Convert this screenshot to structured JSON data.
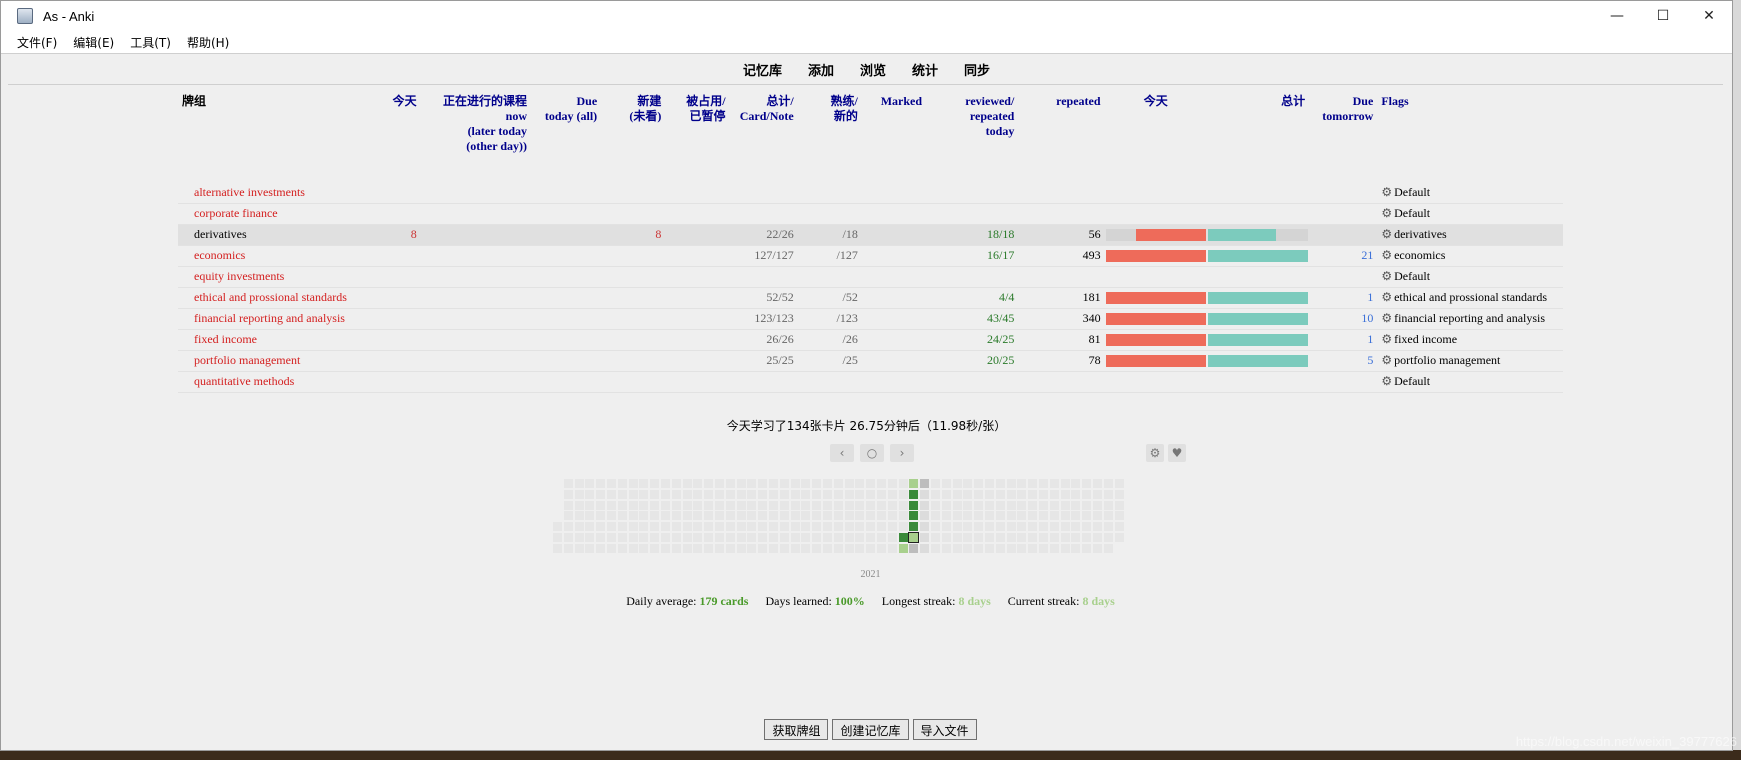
{
  "window": {
    "title": "As - Anki",
    "minimize": "—",
    "maximize": "☐",
    "close": "✕"
  },
  "menu": [
    "文件(F)",
    "编辑(E)",
    "工具(T)",
    "帮助(H)"
  ],
  "toolbar": [
    "记忆库",
    "添加",
    "浏览",
    "统计",
    "同步"
  ],
  "headers": {
    "deck": "牌组",
    "today": "今天",
    "learning": "正在进行的课程\nnow\n(later today\n(other day))",
    "due": "Due\ntoday (all)",
    "new": "新建\n(未看)",
    "buried": "被占用/\n已暂停",
    "total": "总计/\nCard/Note",
    "mature": "熟练/\n新的",
    "marked": "Marked",
    "reviewed": "reviewed/\nrepeated\ntoday",
    "repeated": "repeated",
    "bar_today": "今天",
    "bar_total": "总计",
    "due_tomorrow": "Due\ntomorrow",
    "flags": "Flags"
  },
  "decks": [
    {
      "name": "alternative investments",
      "today": "",
      "new": "",
      "total": "",
      "mature": "",
      "reviewed": "",
      "repeated": "",
      "bar": null,
      "due_tomorrow": "",
      "options": "Default"
    },
    {
      "name": "corporate finance",
      "today": "",
      "new": "",
      "total": "",
      "mature": "",
      "reviewed": "",
      "repeated": "",
      "bar": null,
      "due_tomorrow": "",
      "options": "Default"
    },
    {
      "name": "derivatives",
      "current": true,
      "today": "8",
      "new": "8",
      "total": "22/26",
      "mature": "/18",
      "reviewed": "18/18",
      "repeated": "56",
      "bar": {
        "today_level": 0.7,
        "total_level": 0.68
      },
      "due_tomorrow": "",
      "options": "derivatives"
    },
    {
      "name": "economics",
      "today": "",
      "new": "",
      "total": "127/127",
      "mature": "/127",
      "reviewed": "16/17",
      "repeated": "493",
      "bar": {
        "today_level": 1,
        "total_level": 1
      },
      "due_tomorrow": "21",
      "options": "economics"
    },
    {
      "name": "equity investments",
      "today": "",
      "new": "",
      "total": "",
      "mature": "",
      "reviewed": "",
      "repeated": "",
      "bar": null,
      "due_tomorrow": "",
      "options": "Default"
    },
    {
      "name": "ethical and prossional standards",
      "today": "",
      "new": "",
      "total": "52/52",
      "mature": "/52",
      "reviewed": "4/4",
      "repeated": "181",
      "bar": {
        "today_level": 1,
        "total_level": 1
      },
      "due_tomorrow": "1",
      "options": "ethical and prossional standards"
    },
    {
      "name": "financial reporting and analysis",
      "today": "",
      "new": "",
      "total": "123/123",
      "mature": "/123",
      "reviewed": "43/45",
      "repeated": "340",
      "bar": {
        "today_level": 1,
        "total_level": 1
      },
      "due_tomorrow": "10",
      "options": "financial reporting and analysis"
    },
    {
      "name": "fixed income",
      "today": "",
      "new": "",
      "total": "26/26",
      "mature": "/26",
      "reviewed": "24/25",
      "repeated": "81",
      "bar": {
        "today_level": 1,
        "total_level": 1
      },
      "due_tomorrow": "1",
      "options": "fixed income"
    },
    {
      "name": "portfolio management",
      "today": "",
      "new": "",
      "total": "25/25",
      "mature": "/25",
      "reviewed": "20/25",
      "repeated": "78",
      "bar": {
        "today_level": 1,
        "total_level": 1
      },
      "due_tomorrow": "5",
      "options": "portfolio management"
    },
    {
      "name": "quantitative methods",
      "today": "",
      "new": "",
      "total": "",
      "mature": "",
      "reviewed": "",
      "repeated": "",
      "bar": null,
      "due_tomorrow": "",
      "options": "Default"
    }
  ],
  "summary": "今天学习了134张卡片 26.75分钟后（11.98秒/张）",
  "heatmap_nav": {
    "prev": "‹",
    "today": "○",
    "next": "›",
    "settings": "⚙",
    "heart": "♥"
  },
  "heatmap_year": "2021",
  "stats": {
    "daily_average_label": "Daily average:",
    "daily_average_value": "179 cards",
    "days_learned_label": "Days learned:",
    "days_learned_value": "100%",
    "longest_streak_label": "Longest streak:",
    "longest_streak_value": "8 days",
    "current_streak_label": "Current streak:",
    "current_streak_value": "8 days"
  },
  "bottom_buttons": [
    "获取牌组",
    "创建记忆库",
    "导入文件"
  ],
  "watermark": "https://blog.csdn.net/weixin_39777626",
  "colors": {
    "bar_red": "#ee6b5a",
    "bar_teal": "#7ccbbd",
    "heat_dark": "#3a8a3a",
    "heat_light": "#a8d08d"
  }
}
